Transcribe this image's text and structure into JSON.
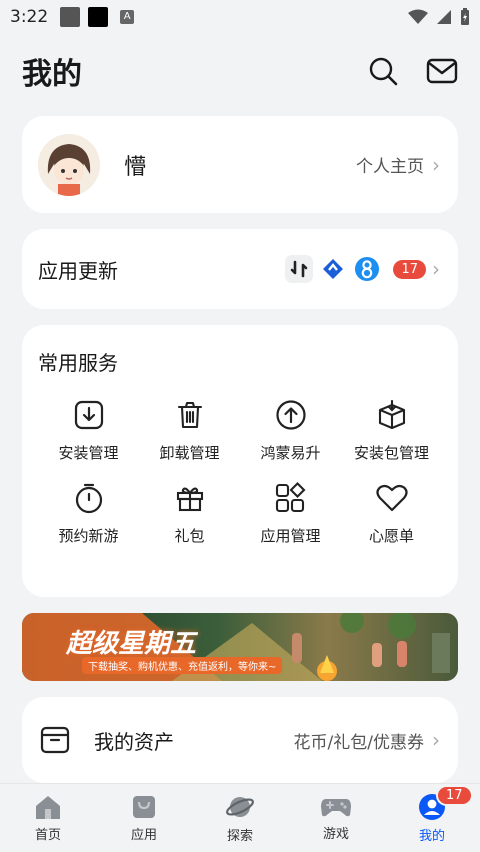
{
  "status_bar": {
    "time": "3:22",
    "notification_letter": "A"
  },
  "header": {
    "title": "我的",
    "icons": [
      "search-icon",
      "mail-icon"
    ]
  },
  "profile": {
    "name": "懵",
    "link_label": "个人主页"
  },
  "updates": {
    "title": "应用更新",
    "count": "17",
    "app_icons": [
      "sync-app-icon",
      "blue-arrow-app-icon",
      "eight-app-icon"
    ]
  },
  "services": {
    "title": "常用服务",
    "items": [
      {
        "label": "安装管理",
        "icon": "install-icon"
      },
      {
        "label": "卸载管理",
        "icon": "trash-icon"
      },
      {
        "label": "鸿蒙易升",
        "icon": "upgrade-icon"
      },
      {
        "label": "安装包管理",
        "icon": "package-icon"
      },
      {
        "label": "预约新游",
        "icon": "timer-icon"
      },
      {
        "label": "礼包",
        "icon": "gift-icon"
      },
      {
        "label": "应用管理",
        "icon": "apps-grid-icon"
      },
      {
        "label": "心愿单",
        "icon": "heart-icon"
      }
    ]
  },
  "banner": {
    "title": "超级星期五",
    "subtitle": "下载抽奖、购机优惠、充值返利，等你来~"
  },
  "assets": {
    "title": "我的资产",
    "detail": "花币/礼包/优惠券"
  },
  "tabbar": {
    "tabs": [
      {
        "label": "首页",
        "icon": "home-icon"
      },
      {
        "label": "应用",
        "icon": "shopping-bag-icon"
      },
      {
        "label": "探索",
        "icon": "planet-icon"
      },
      {
        "label": "游戏",
        "icon": "gamepad-icon"
      },
      {
        "label": "我的",
        "icon": "user-icon",
        "badge": "17",
        "active": true
      }
    ]
  },
  "colors": {
    "accent": "#0a59f7",
    "badge": "#e84a3c",
    "background": "#f1f3f5"
  }
}
